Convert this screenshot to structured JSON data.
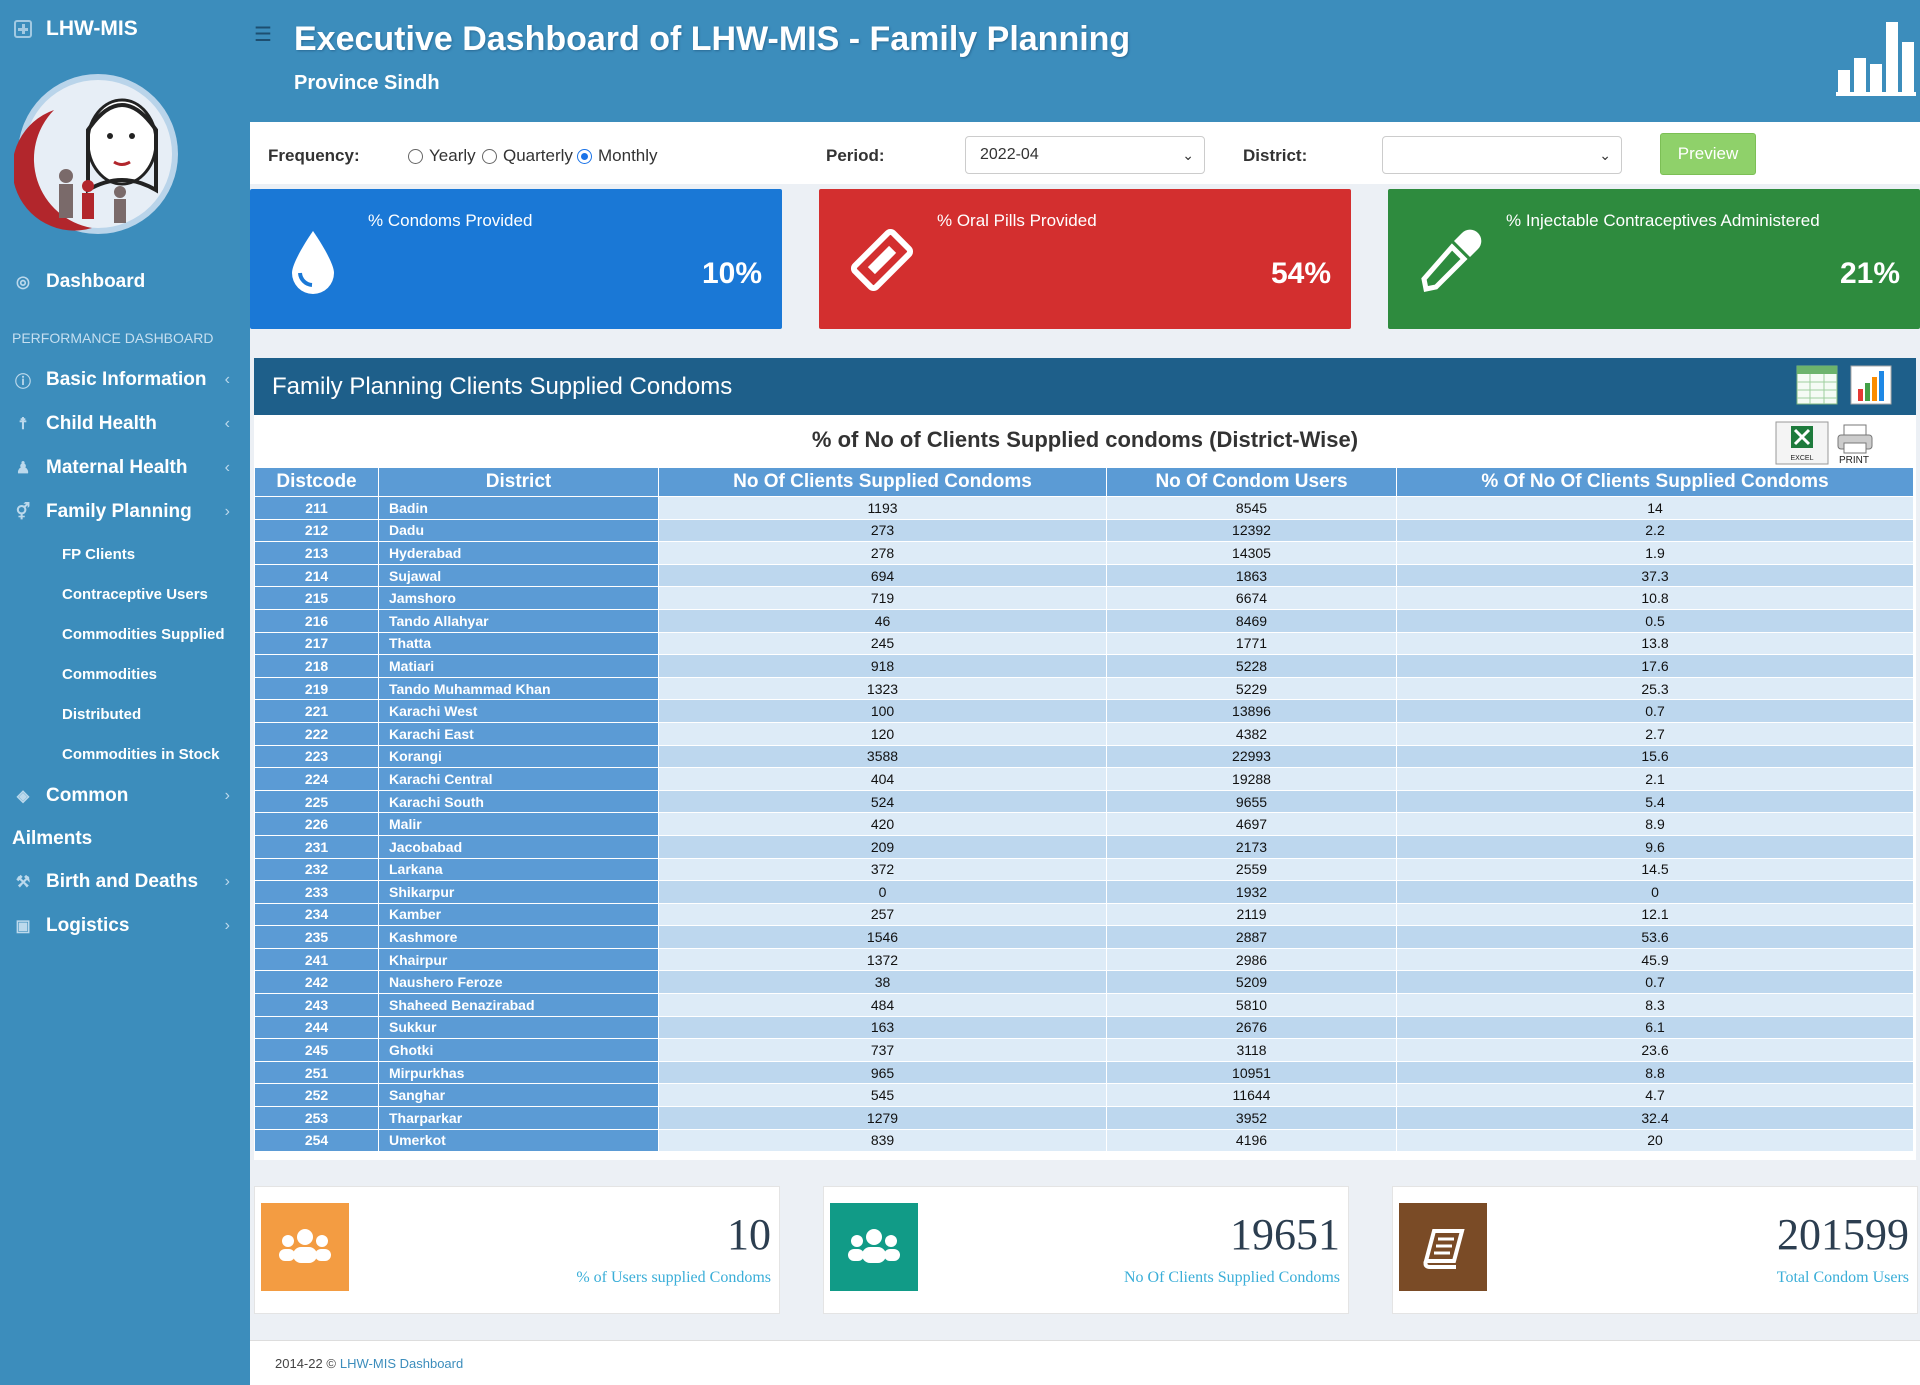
{
  "brand": "LHW-MIS",
  "sidebar": {
    "dashboard": "Dashboard",
    "section_header": "PERFORMANCE DASHBOARD",
    "items": [
      {
        "label": "Basic Information"
      },
      {
        "label": "Child Health"
      },
      {
        "label": "Maternal Health"
      },
      {
        "label": "Family Planning"
      }
    ],
    "sub_items": [
      "FP Clients",
      "Contraceptive Users",
      "Commodities Supplied",
      "Commodities",
      "Distributed",
      "Commodities in Stock"
    ],
    "common": "Common",
    "ailments": "Ailments",
    "birth_deaths": "Birth and Deaths",
    "logistics": "Logistics"
  },
  "header": {
    "title": "Executive Dashboard of LHW-MIS - Family Planning",
    "subtitle": "Province Sindh"
  },
  "filters": {
    "frequency_label": "Frequency:",
    "options": [
      "Yearly",
      "Quarterly",
      "Monthly"
    ],
    "selected": "Monthly",
    "period_label": "Period:",
    "period_value": "2022-04",
    "district_label": "District:",
    "district_value": "",
    "preview": "Preview"
  },
  "kpi_cards": [
    {
      "label": "% Condoms Provided",
      "value": "10%",
      "color": "#1a78d6"
    },
    {
      "label": "% Oral Pills Provided",
      "value": "54%",
      "color": "#d32f2f"
    },
    {
      "label": "% Injectable Contraceptives Administered",
      "value": "21%",
      "color": "#2e8b3e"
    }
  ],
  "panel": {
    "title": "Family Planning Clients Supplied Condoms",
    "table_title": "% of No of Clients Supplied condoms (District-Wise)",
    "excel_label": "EXCEL",
    "print_label": "PRINT"
  },
  "table": {
    "headers": [
      "Distcode",
      "District",
      "No Of Clients Supplied Condoms",
      "No Of Condom Users",
      "% Of No Of Clients Supplied Condoms"
    ],
    "rows": [
      [
        "211",
        "Badin",
        "1193",
        "8545",
        "14"
      ],
      [
        "212",
        "Dadu",
        "273",
        "12392",
        "2.2"
      ],
      [
        "213",
        "Hyderabad",
        "278",
        "14305",
        "1.9"
      ],
      [
        "214",
        "Sujawal",
        "694",
        "1863",
        "37.3"
      ],
      [
        "215",
        "Jamshoro",
        "719",
        "6674",
        "10.8"
      ],
      [
        "216",
        "Tando Allahyar",
        "46",
        "8469",
        "0.5"
      ],
      [
        "217",
        "Thatta",
        "245",
        "1771",
        "13.8"
      ],
      [
        "218",
        "Matiari",
        "918",
        "5228",
        "17.6"
      ],
      [
        "219",
        "Tando Muhammad Khan",
        "1323",
        "5229",
        "25.3"
      ],
      [
        "221",
        "Karachi West",
        "100",
        "13896",
        "0.7"
      ],
      [
        "222",
        "Karachi East",
        "120",
        "4382",
        "2.7"
      ],
      [
        "223",
        "Korangi",
        "3588",
        "22993",
        "15.6"
      ],
      [
        "224",
        "Karachi Central",
        "404",
        "19288",
        "2.1"
      ],
      [
        "225",
        "Karachi South",
        "524",
        "9655",
        "5.4"
      ],
      [
        "226",
        "Malir",
        "420",
        "4697",
        "8.9"
      ],
      [
        "231",
        "Jacobabad",
        "209",
        "2173",
        "9.6"
      ],
      [
        "232",
        "Larkana",
        "372",
        "2559",
        "14.5"
      ],
      [
        "233",
        "Shikarpur",
        "0",
        "1932",
        "0"
      ],
      [
        "234",
        "Kamber",
        "257",
        "2119",
        "12.1"
      ],
      [
        "235",
        "Kashmore",
        "1546",
        "2887",
        "53.6"
      ],
      [
        "241",
        "Khairpur",
        "1372",
        "2986",
        "45.9"
      ],
      [
        "242",
        "Naushero Feroze",
        "38",
        "5209",
        "0.7"
      ],
      [
        "243",
        "Shaheed Benazirabad",
        "484",
        "5810",
        "8.3"
      ],
      [
        "244",
        "Sukkur",
        "163",
        "2676",
        "6.1"
      ],
      [
        "245",
        "Ghotki",
        "737",
        "3118",
        "23.6"
      ],
      [
        "251",
        "Mirpurkhas",
        "965",
        "10951",
        "8.8"
      ],
      [
        "252",
        "Sanghar",
        "545",
        "11644",
        "4.7"
      ],
      [
        "253",
        "Tharparkar",
        "1279",
        "3952",
        "32.4"
      ],
      [
        "254",
        "Umerkot",
        "839",
        "4196",
        "20"
      ]
    ]
  },
  "stats": [
    {
      "value": "10",
      "label": "% of Users supplied Condoms",
      "color": "#f39c42"
    },
    {
      "value": "19651",
      "label": "No Of Clients Supplied Condoms",
      "color": "#119b87"
    },
    {
      "value": "201599",
      "label": "Total Condom Users",
      "color": "#7a4b26"
    }
  ],
  "footer": {
    "copyright": "2014-22 ©",
    "link": "LHW-MIS Dashboard"
  }
}
